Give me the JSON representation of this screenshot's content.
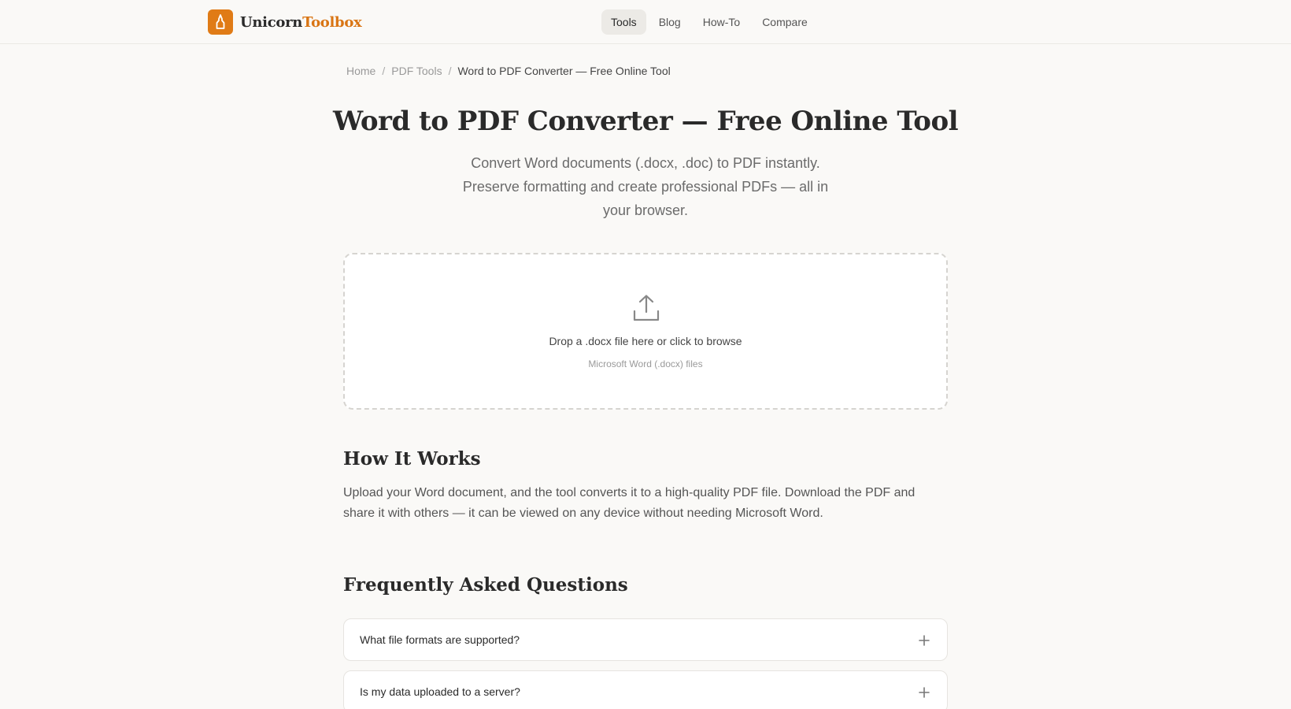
{
  "header": {
    "logo_part1": "Unicorn",
    "logo_part2": "Toolbox",
    "brand_color": "#e07b16",
    "nav": [
      {
        "label": "Tools",
        "active": true
      },
      {
        "label": "Blog",
        "active": false
      },
      {
        "label": "How-To",
        "active": false
      },
      {
        "label": "Compare",
        "active": false
      }
    ]
  },
  "breadcrumb": {
    "home": "Home",
    "sep": "/",
    "section": "PDF Tools",
    "current": "Word to PDF Converter — Free Online Tool"
  },
  "page": {
    "title": "Word to PDF Converter — Free Online Tool",
    "subtitle": "Convert Word documents (.docx, .doc) to PDF instantly. Preserve formatting and create professional PDFs — all in your browser."
  },
  "dropzone": {
    "icon": "upload-icon",
    "main_text": "Drop a .docx file here or click to browse",
    "sub_text": "Microsoft Word (.docx) files"
  },
  "how_it_works": {
    "title": "How It Works",
    "body": "Upload your Word document, and the tool converts it to a high-quality PDF file. Download the PDF and share it with others — it can be viewed on any device without needing Microsoft Word."
  },
  "faq": {
    "title": "Frequently Asked Questions",
    "items": [
      {
        "question": "What file formats are supported?"
      },
      {
        "question": "Is my data uploaded to a server?"
      }
    ]
  }
}
